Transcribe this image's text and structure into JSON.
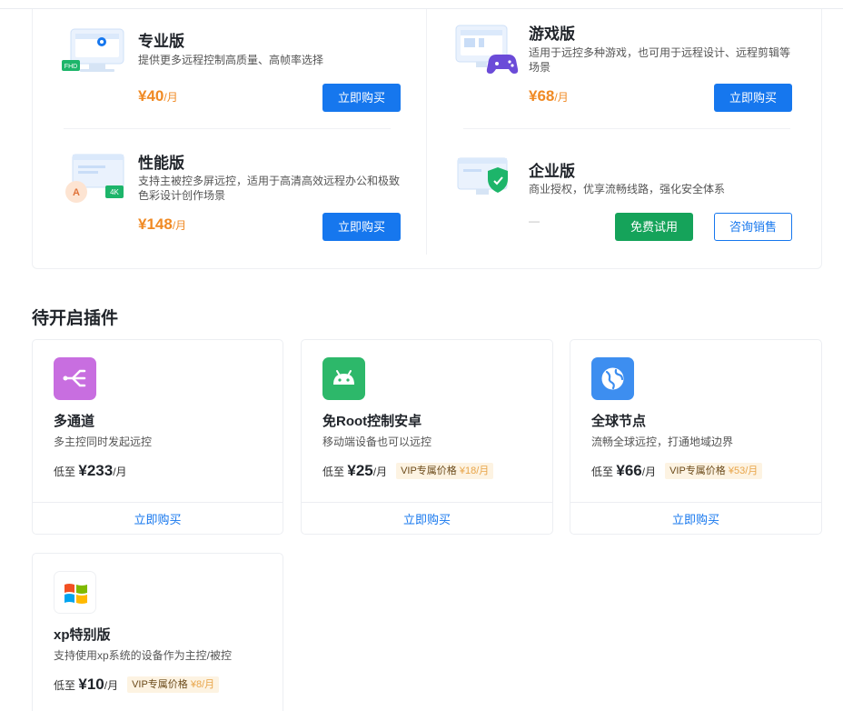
{
  "versions": [
    {
      "id": "pro",
      "title": "专业版",
      "desc": "提供更多远程控制高质量、高帧率选择",
      "price": "¥40",
      "unit": "/月",
      "button": "立即购买",
      "icon": "monitor-fhd-icon"
    },
    {
      "id": "game",
      "title": "游戏版",
      "desc": "适用于远控多种游戏，也可用于远程设计、远程剪辑等场景",
      "price": "¥68",
      "unit": "/月",
      "button": "立即购买",
      "icon": "gamepad-monitor-icon"
    },
    {
      "id": "perf",
      "title": "性能版",
      "desc": "支持主被控多屏远控，适用于高清高效远程办公和极致色彩设计创作场景",
      "price": "¥148",
      "unit": "/月",
      "button": "立即购买",
      "icon": "multiscreen-4k-icon"
    },
    {
      "id": "enterprise",
      "title": "企业版",
      "desc": "商业授权，优享流畅线路，强化安全体系",
      "price": "—",
      "trial_button": "免费试用",
      "consult_button": "咨询销售",
      "icon": "shield-monitor-icon"
    }
  ],
  "plugins_section": {
    "title": "待开启插件"
  },
  "plugins": [
    {
      "name": "多通道",
      "desc": "多主控同时发起远控",
      "price_prefix": "低至",
      "price": "¥233",
      "unit": "/月",
      "vip_label": "",
      "vip_price": "",
      "button": "立即购买",
      "icon": "multichannel-icon",
      "color": "#c86ee0"
    },
    {
      "name": "免Root控制安卓",
      "desc": "移动端设备也可以远控",
      "price_prefix": "低至",
      "price": "¥25",
      "unit": "/月",
      "vip_label": "VIP专属价格",
      "vip_price": "¥18/月",
      "button": "立即购买",
      "icon": "android-icon",
      "color": "#2db86a"
    },
    {
      "name": "全球节点",
      "desc": "流畅全球远控，打通地域边界",
      "price_prefix": "低至",
      "price": "¥66",
      "unit": "/月",
      "vip_label": "VIP专属价格",
      "vip_price": "¥53/月",
      "button": "立即购买",
      "icon": "globe-icon",
      "color": "#3d8ef0"
    },
    {
      "name": "xp特别版",
      "desc": "支持使用xp系统的设备作为主控/被控",
      "price_prefix": "低至",
      "price": "¥10",
      "unit": "/月",
      "vip_label": "VIP专属价格",
      "vip_price": "¥8/月",
      "button": "",
      "icon": "windows-xp-icon",
      "color": "#ffffff"
    }
  ]
}
